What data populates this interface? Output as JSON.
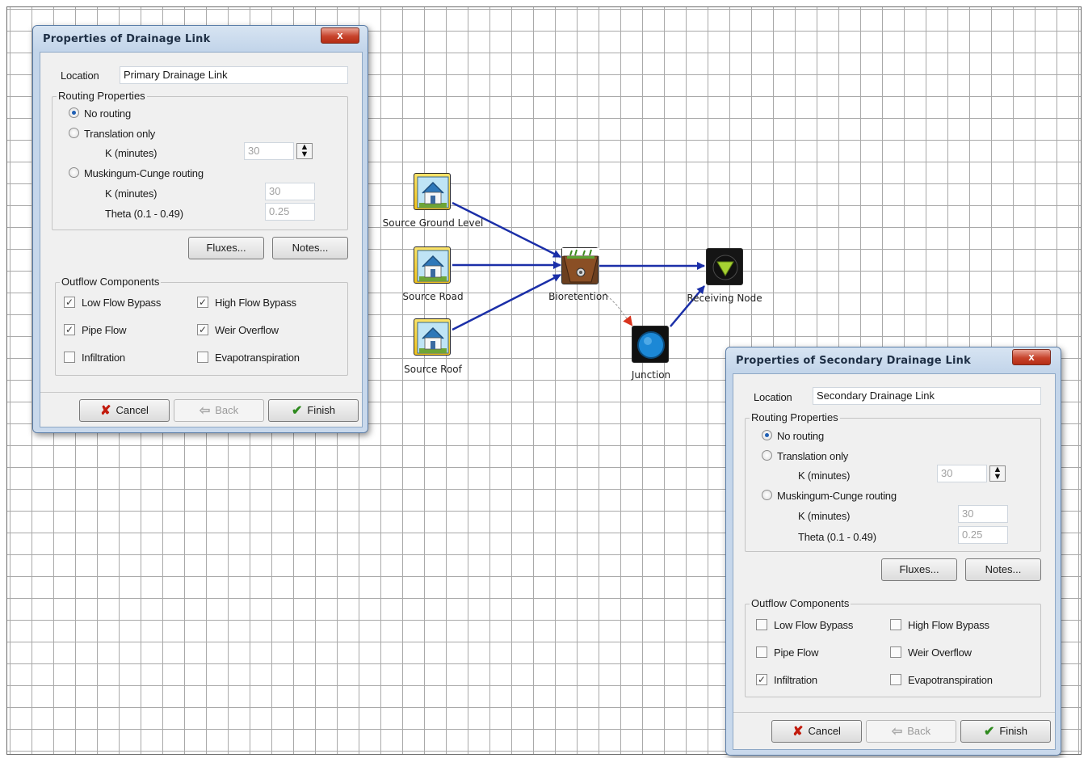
{
  "diagram": {
    "nodes": {
      "source_ground_level": "Source Ground Level",
      "source_road": "Source Road",
      "source_roof": "Source Roof",
      "bioretention": "Bioretention",
      "receiving_node": "Receiving Node",
      "junction": "Junction"
    },
    "colors": {
      "link": "#1b2fa8",
      "secondary_link": "#d9331d",
      "source_icon_bg": "#f6d43a",
      "junction": "#1c88d6",
      "receiving_marker": "#a6d132"
    }
  },
  "dialog1": {
    "title": "Properties of Drainage Link",
    "close": "x",
    "location_label": "Location",
    "location_value": "Primary Drainage Link",
    "routing_title": "Routing Properties",
    "no_routing": "No routing",
    "translation_only": "Translation only",
    "k_minutes": "K (minutes)",
    "translation_k": "30",
    "muskingum": "Muskingum-Cunge routing",
    "muskingum_k": "30",
    "theta_label": "Theta (0.1 - 0.49)",
    "theta_value": "0.25",
    "fluxes": "Fluxes...",
    "notes": "Notes...",
    "outflow_title": "Outflow Components",
    "low_flow": "Low Flow Bypass",
    "high_flow": "High Flow Bypass",
    "pipe_flow": "Pipe Flow",
    "weir": "Weir Overflow",
    "infiltration": "Infiltration",
    "evapo": "Evapotranspiration",
    "cancel": "Cancel",
    "back": "Back",
    "finish": "Finish",
    "checked": {
      "low_flow": true,
      "high_flow": true,
      "pipe_flow": true,
      "weir": true,
      "infiltration": false,
      "evapo": false
    },
    "routing_selected": "no_routing"
  },
  "dialog2": {
    "title": "Properties of Secondary Drainage Link",
    "close": "x",
    "location_label": "Location",
    "location_value": "Secondary Drainage Link",
    "routing_title": "Routing Properties",
    "no_routing": "No routing",
    "translation_only": "Translation only",
    "k_minutes": "K (minutes)",
    "translation_k": "30",
    "muskingum": "Muskingum-Cunge routing",
    "muskingum_k": "30",
    "theta_label": "Theta (0.1 - 0.49)",
    "theta_value": "0.25",
    "fluxes": "Fluxes...",
    "notes": "Notes...",
    "outflow_title": "Outflow Components",
    "low_flow": "Low Flow Bypass",
    "high_flow": "High Flow Bypass",
    "pipe_flow": "Pipe Flow",
    "weir": "Weir Overflow",
    "infiltration": "Infiltration",
    "evapo": "Evapotranspiration",
    "cancel": "Cancel",
    "back": "Back",
    "finish": "Finish",
    "checked": {
      "low_flow": false,
      "high_flow": false,
      "pipe_flow": false,
      "weir": false,
      "infiltration": true,
      "evapo": false
    },
    "routing_selected": "no_routing"
  }
}
